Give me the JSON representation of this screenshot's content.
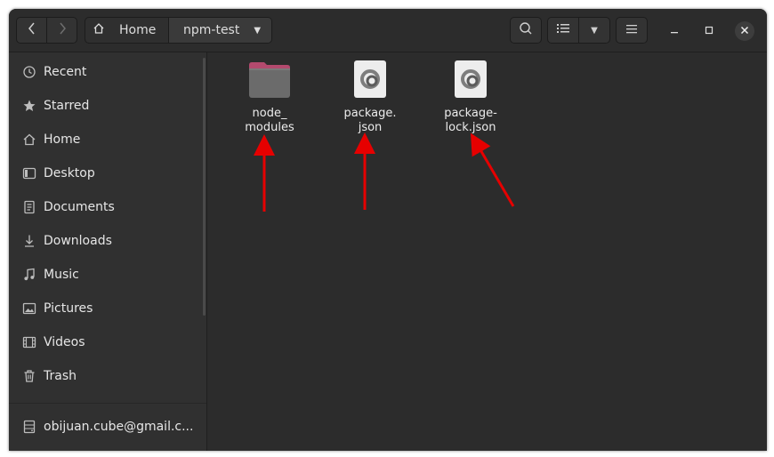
{
  "headerbar": {
    "path": [
      {
        "label": "Home",
        "icon": "home-icon"
      },
      {
        "label": "npm-test",
        "icon": "chevron-down-icon"
      }
    ]
  },
  "sidebar": {
    "items": [
      {
        "label": "Recent",
        "icon": "clock-icon"
      },
      {
        "label": "Starred",
        "icon": "star-icon"
      },
      {
        "label": "Home",
        "icon": "home-icon"
      },
      {
        "label": "Desktop",
        "icon": "desktop-icon"
      },
      {
        "label": "Documents",
        "icon": "document-icon"
      },
      {
        "label": "Downloads",
        "icon": "download-icon"
      },
      {
        "label": "Music",
        "icon": "music-icon"
      },
      {
        "label": "Pictures",
        "icon": "picture-icon"
      },
      {
        "label": "Videos",
        "icon": "video-icon"
      },
      {
        "label": "Trash",
        "icon": "trash-icon"
      }
    ],
    "account": {
      "label": "obijuan.cube@gmail.c...",
      "icon": "network-drive-icon"
    }
  },
  "files": [
    {
      "name": "node_\nmodules",
      "icon": "folder-icon"
    },
    {
      "name": "package.\njson",
      "icon": "json-file-icon"
    },
    {
      "name": "package-\nlock.json",
      "icon": "json-file-icon"
    }
  ],
  "colors": {
    "accent_folder": "#b34a6e",
    "annotation_arrow": "#e60000"
  }
}
